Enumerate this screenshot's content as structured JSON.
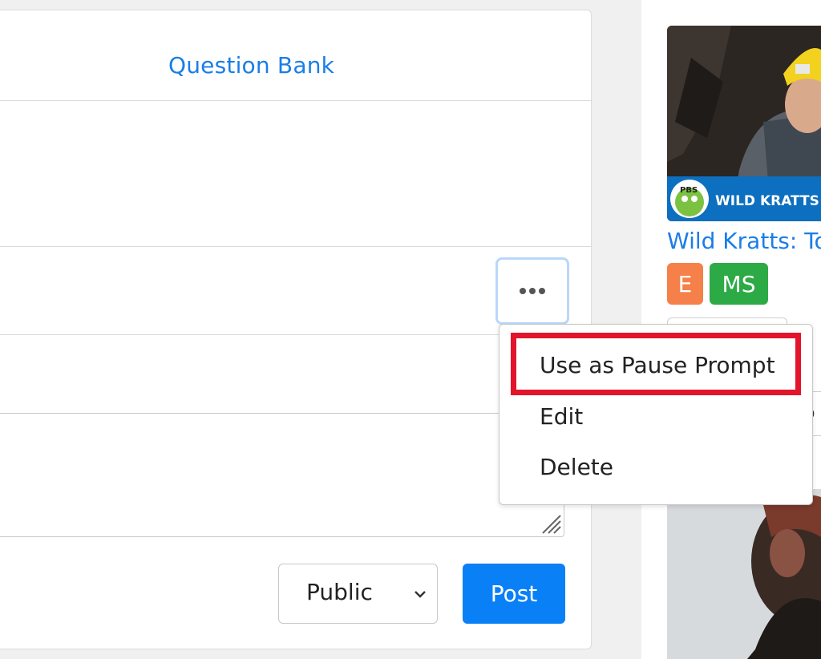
{
  "main": {
    "tab_label": "Question Bank",
    "visibility": {
      "selected": "Public"
    },
    "post_label": "Post",
    "more_icon": "ellipsis-icon"
  },
  "dropdown": {
    "items": [
      "Use as Pause Prompt",
      "Edit",
      "Delete"
    ]
  },
  "sidebar": {
    "video_title": "Wild Kratts: To",
    "thumb_brand": "PBS KIDS",
    "thumb_show": "WILD KRATTS",
    "badges": [
      "E",
      "MS"
    ],
    "partial_input_text": "o"
  },
  "colors": {
    "link": "#1a7ee6",
    "primary": "#0a80f7",
    "highlight": "#e3152b",
    "badge_e": "#f5804a",
    "badge_ms": "#2caa45"
  }
}
